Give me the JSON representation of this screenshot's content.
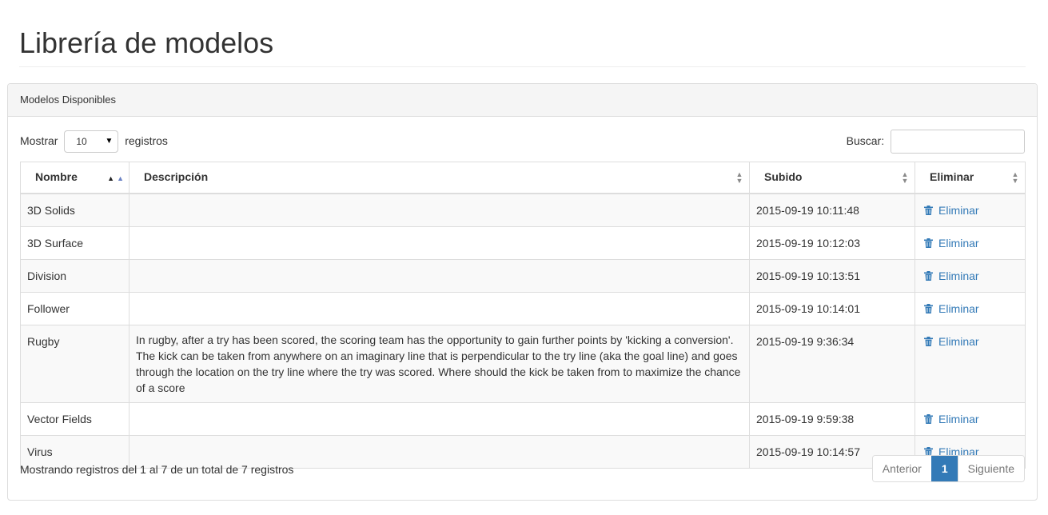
{
  "page": {
    "title": "Librería de modelos"
  },
  "panel": {
    "heading": "Modelos Disponibles"
  },
  "controls": {
    "show_label": "Mostrar",
    "length_value": "10",
    "records_label": "registros",
    "search_label": "Buscar:",
    "search_value": ""
  },
  "table": {
    "columns": [
      "Nombre",
      "Descripción",
      "Subido",
      "Eliminar"
    ],
    "rows": [
      {
        "name": "3D Solids",
        "description": "",
        "uploaded": "2015-09-19 10:11:48",
        "action": "Eliminar"
      },
      {
        "name": "3D Surface",
        "description": "",
        "uploaded": "2015-09-19 10:12:03",
        "action": "Eliminar"
      },
      {
        "name": "Division",
        "description": "",
        "uploaded": "2015-09-19 10:13:51",
        "action": "Eliminar"
      },
      {
        "name": "Follower",
        "description": "",
        "uploaded": "2015-09-19 10:14:01",
        "action": "Eliminar"
      },
      {
        "name": "Rugby",
        "description": "In rugby, after a try has been scored, the scoring team has the opportunity to gain further points by 'kicking a conversion'. The kick can be taken from anywhere on an imaginary line that is perpendicular to the try line (aka the goal line) and goes through the location on the try line where the try was scored. Where should the kick be taken from to maximize the chance of a score",
        "uploaded": "2015-09-19 9:36:34",
        "action": "Eliminar"
      },
      {
        "name": "Vector Fields",
        "description": "",
        "uploaded": "2015-09-19 9:59:38",
        "action": "Eliminar"
      },
      {
        "name": "Virus",
        "description": "",
        "uploaded": "2015-09-19 10:14:57",
        "action": "Eliminar"
      }
    ]
  },
  "footer": {
    "info": "Mostrando registros del 1 al 7 de un total de 7 registros",
    "prev": "Anterior",
    "current_page": "1",
    "next": "Siguiente"
  },
  "icons": {
    "delete": "trash-icon",
    "sort_both": "sort-both-icon",
    "sort_asc": "sort-asc-icon"
  },
  "colors": {
    "link": "#337ab7",
    "active_page": "#337ab7",
    "stripe": "#f9f9f9",
    "border": "#dddddd"
  }
}
